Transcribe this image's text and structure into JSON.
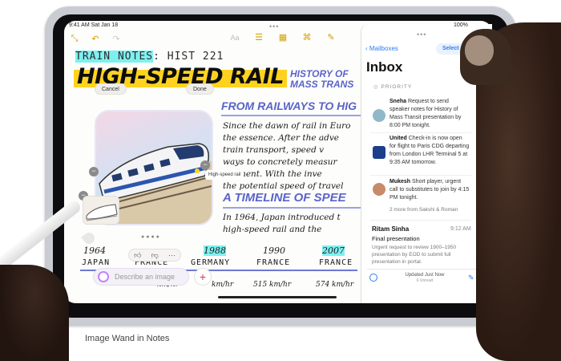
{
  "status": {
    "time": "9:41 AM Sat Jan 18",
    "indicators": "100%"
  },
  "notes": {
    "toolbar_left_icons": [
      "collapse-icon",
      "undo-icon",
      "redo-icon"
    ],
    "toolbar_right_icons": [
      "text-format-icon",
      "checklist-icon",
      "table-icon",
      "attachment-icon",
      "markup-icon"
    ],
    "title_hl": "TRAIN NOTES",
    "title_rest": ": HIST 221",
    "headline": "HIGH-SPEED RAIL",
    "history": "HISTORY OF\nMASS TRANS",
    "cancel_label": "Cancel",
    "done_label": "Done",
    "subheading1": "FROM RAILWAYS TO HIG",
    "para1": [
      "Since the dawn of rail in Euro",
      "the essence. After the adve",
      "train transport, speed v",
      "ways to concretely measur",
      "ncement. With the inve",
      "the potential speed of travel"
    ],
    "subheading2": "A TIMELINE OF SPEE",
    "para2": [
      "In 1964, Japan introduced t",
      "high-speed rail and the"
    ],
    "image_chip": "High-speed rail",
    "wand_placeholder": "Describe an image",
    "react_icons": [
      "thumbs-up-icon",
      "thumbs-down-icon",
      "more-icon"
    ],
    "timeline": {
      "years": [
        "1964",
        "1988",
        "1990",
        "2007"
      ],
      "countries": [
        "JAPAN",
        "FRANCE",
        "GERMANY",
        "FRANCE",
        "FRANCE"
      ],
      "speeds": [
        "km/hr",
        "km/hr",
        "515 km/hr",
        "574 km/hr"
      ]
    }
  },
  "mail": {
    "back_label": "Mailboxes",
    "select_label": "Select",
    "inbox_title": "Inbox",
    "priority_label": "PRIORITY",
    "items": [
      {
        "sender": "Sneha",
        "body": "Request to send speaker notes for History of Mass Transit presentation by 8:00 PM tonight."
      },
      {
        "sender": "United",
        "body": "Check-in is now open for flight to Paris CDG departing from London LHR Terminal 5 at 9:35 AM tomorrow."
      },
      {
        "sender": "Mukesh",
        "body": "Short player, urgent call to substitutes to join by 4:15 PM tonight."
      }
    ],
    "more_label": "2 more from Sakshi & Roman",
    "ritam": {
      "name": "Ritam Sinha",
      "time": "9:12 AM",
      "subject": "Final presentation",
      "body": "Urgent request to review 1900–1950 presentation by EOD to submit full presentation in portal."
    },
    "updated": "Updated Just Now",
    "unread": "6 Unread"
  },
  "caption": "Image Wand in Notes",
  "colors": {
    "highlight_yellow": "#ffd21e",
    "highlight_cyan": "#7ff0f0",
    "ink_blue": "#5a63c8",
    "mail_blue": "#2d7cf6"
  }
}
